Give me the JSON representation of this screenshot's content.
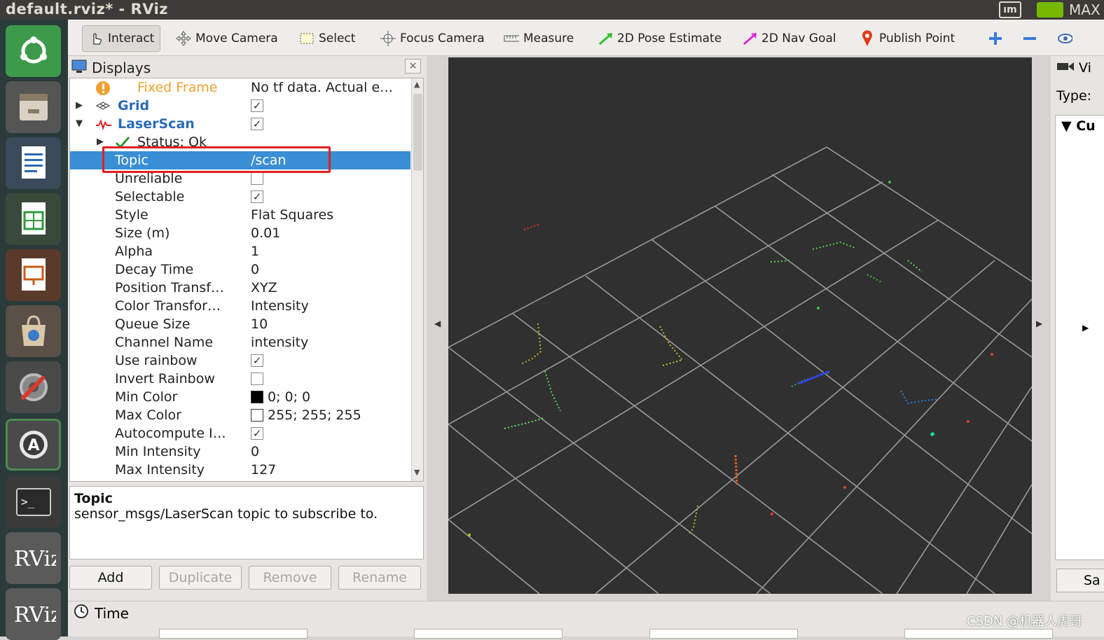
{
  "window": {
    "title": "default.rviz* - RViz",
    "tray_text": "MAX",
    "tray_ime": "ım"
  },
  "toolbar": {
    "tools": [
      {
        "label": "Interact",
        "icon": "hand-pointer-icon",
        "selected": true
      },
      {
        "label": "Move Camera",
        "icon": "move-camera-icon"
      },
      {
        "label": "Select",
        "icon": "select-box-icon"
      },
      {
        "label": "Focus Camera",
        "icon": "focus-camera-icon"
      },
      {
        "label": "Measure",
        "icon": "ruler-icon"
      },
      {
        "label": "2D Pose Estimate",
        "icon": "green-arrow-icon"
      },
      {
        "label": "2D Nav Goal",
        "icon": "pink-arrow-icon"
      },
      {
        "label": "Publish Point",
        "icon": "map-pin-icon"
      }
    ]
  },
  "displays": {
    "title": "Displays",
    "close": "×",
    "rows": [
      {
        "name": "Fixed Frame",
        "value": "No tf data.  Actual e…",
        "kind": "warning"
      },
      {
        "name": "Grid",
        "kind": "display",
        "checked": true
      },
      {
        "name": "LaserScan",
        "kind": "display",
        "checked": true
      },
      {
        "name": "Status: Ok",
        "kind": "status"
      },
      {
        "name": "Topic",
        "value": "/scan",
        "selected": true
      },
      {
        "name": "Unreliable",
        "checked": false
      },
      {
        "name": "Selectable",
        "checked": true
      },
      {
        "name": "Style",
        "value": "Flat Squares"
      },
      {
        "name": "Size (m)",
        "value": "0.01"
      },
      {
        "name": "Alpha",
        "value": "1"
      },
      {
        "name": "Decay Time",
        "value": "0"
      },
      {
        "name": "Position Transf…",
        "value": "XYZ"
      },
      {
        "name": "Color Transfor…",
        "value": "Intensity"
      },
      {
        "name": "Queue Size",
        "value": "10"
      },
      {
        "name": "Channel Name",
        "value": "intensity"
      },
      {
        "name": "Use rainbow",
        "checked": true
      },
      {
        "name": "Invert Rainbow",
        "checked": false
      },
      {
        "name": "Min Color",
        "value": "0; 0; 0",
        "swatch": "#000000"
      },
      {
        "name": "Max Color",
        "value": "255; 255; 255",
        "swatch": "#ffffff"
      },
      {
        "name": "Autocompute I…",
        "checked": true
      },
      {
        "name": "Min Intensity",
        "value": "0"
      },
      {
        "name": "Max Intensity",
        "value": "127"
      }
    ],
    "description": {
      "title": "Topic",
      "text": "sensor_msgs/LaserScan topic to subscribe to."
    },
    "buttons": {
      "add": "Add",
      "duplicate": "Duplicate",
      "remove": "Remove",
      "rename": "Rename"
    }
  },
  "views": {
    "header": "Vi",
    "type_label": "Type:",
    "current": "Cu",
    "save": "Sa"
  },
  "time": {
    "title": "Time"
  },
  "watermark": "CSDN @机器人虎哥",
  "colors": {
    "selection": "#3a8ed3",
    "highlight_box": "#e02020",
    "warning": "#f0a030",
    "viewport_bg": "#303030",
    "grid": "#a0a0a0"
  }
}
